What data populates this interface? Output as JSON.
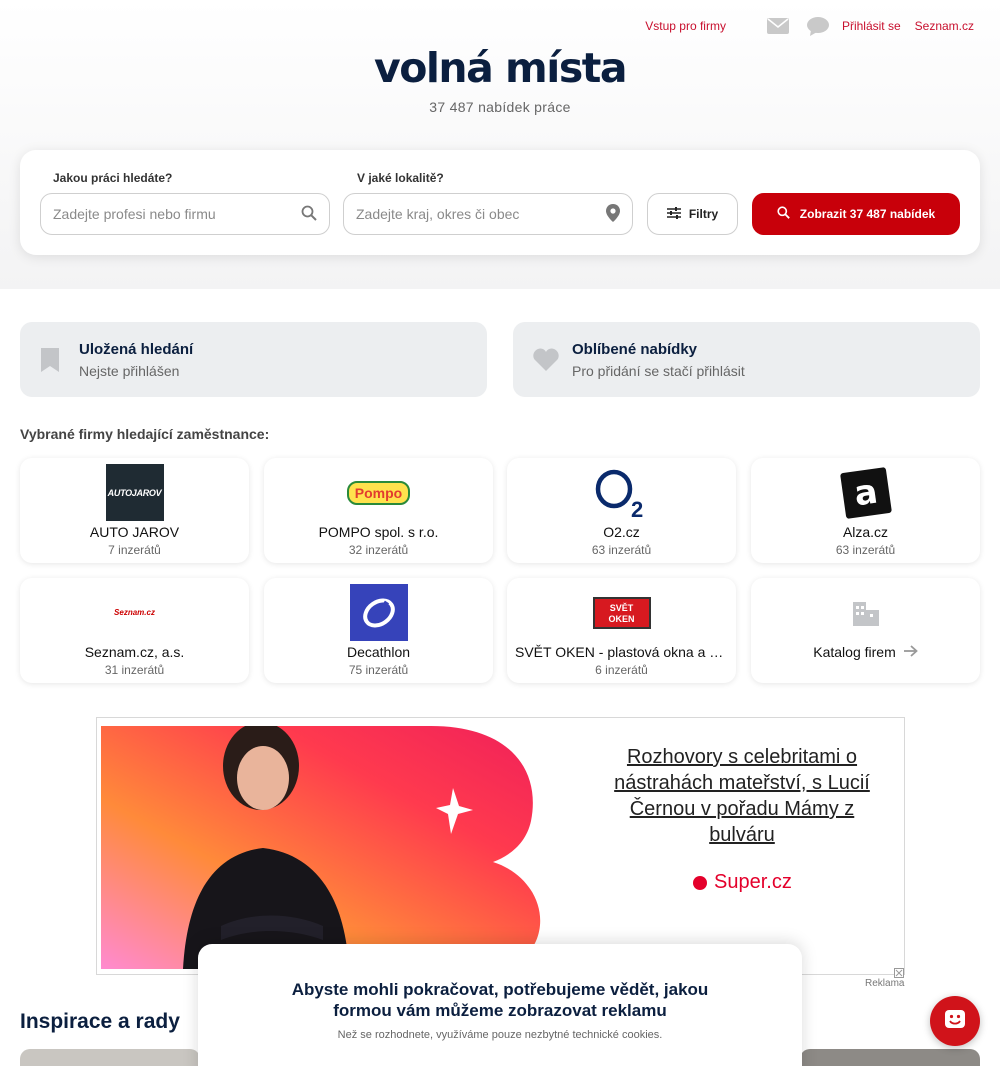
{
  "topnav": {
    "firms_link": "Vstup pro firmy",
    "mail_icon": "mail-icon",
    "chat_icon": "chat-icon",
    "login": "Přihlásit se",
    "seznam": "Seznam.cz"
  },
  "hero": {
    "title": "volná místa",
    "subtitle": "37 487 nabídek práce"
  },
  "search": {
    "job_label": "Jakou práci hledáte?",
    "job_placeholder": "Zadejte profesi nebo firmu",
    "location_label": "V jaké lokalitě?",
    "location_placeholder": "Zadejte kraj, okres či obec",
    "filters_label": "Filtry",
    "submit_label": "Zobrazit 37 487 nabídek"
  },
  "tiles": [
    {
      "title": "Uložená hledání",
      "subtitle": "Nejste přihlášen",
      "icon": "bookmark-icon"
    },
    {
      "title": "Oblíbené nabídky",
      "subtitle": "Pro přidání se stačí přihlásit",
      "icon": "heart-icon"
    }
  ],
  "companies_section": {
    "label": "Vybrané firmy hledající zaměstnance:",
    "items": [
      {
        "name": "AUTO JAROV",
        "count": "7 inzerátů",
        "logo_text": "AUTOJAROV"
      },
      {
        "name": "POMPO spol. s r.o.",
        "count": "32 inzerátů",
        "logo_text": "Pompo"
      },
      {
        "name": "O2.cz",
        "count": "63 inzerátů",
        "logo_text": "O"
      },
      {
        "name": "Alza.cz",
        "count": "63 inzerátů",
        "logo_text": "a"
      },
      {
        "name": "Seznam.cz, a.s.",
        "count": "31 inzerátů",
        "logo_text": "Seznam.cz"
      },
      {
        "name": "Decathlon",
        "count": "75 inzerátů",
        "logo_text": ""
      },
      {
        "name": "SVĚT OKEN - plastová okna a dveře",
        "count": "6 inzerátů",
        "logo_text": "SVĚT OKEN"
      }
    ],
    "catalog_label": "Katalog firem"
  },
  "ad": {
    "headline": "Rozhovory s celebritami o nástrahách mateřství, s Lucií Černou v pořadu Mámy z bulváru",
    "brand": "Super.cz",
    "label": "Reklama"
  },
  "inspiration": {
    "title": "Inspirace a rady"
  },
  "consent": {
    "heading": "Abyste mohli pokračovat, potřebujeme vědět, jakou formou vám můžeme zobrazovat reklamu",
    "body": "Než se rozhodnete, využíváme pouze nezbytné technické cookies."
  },
  "colors": {
    "accent_red": "#c8000a",
    "link_red": "#c8102e",
    "navy": "#0b1f3f"
  }
}
